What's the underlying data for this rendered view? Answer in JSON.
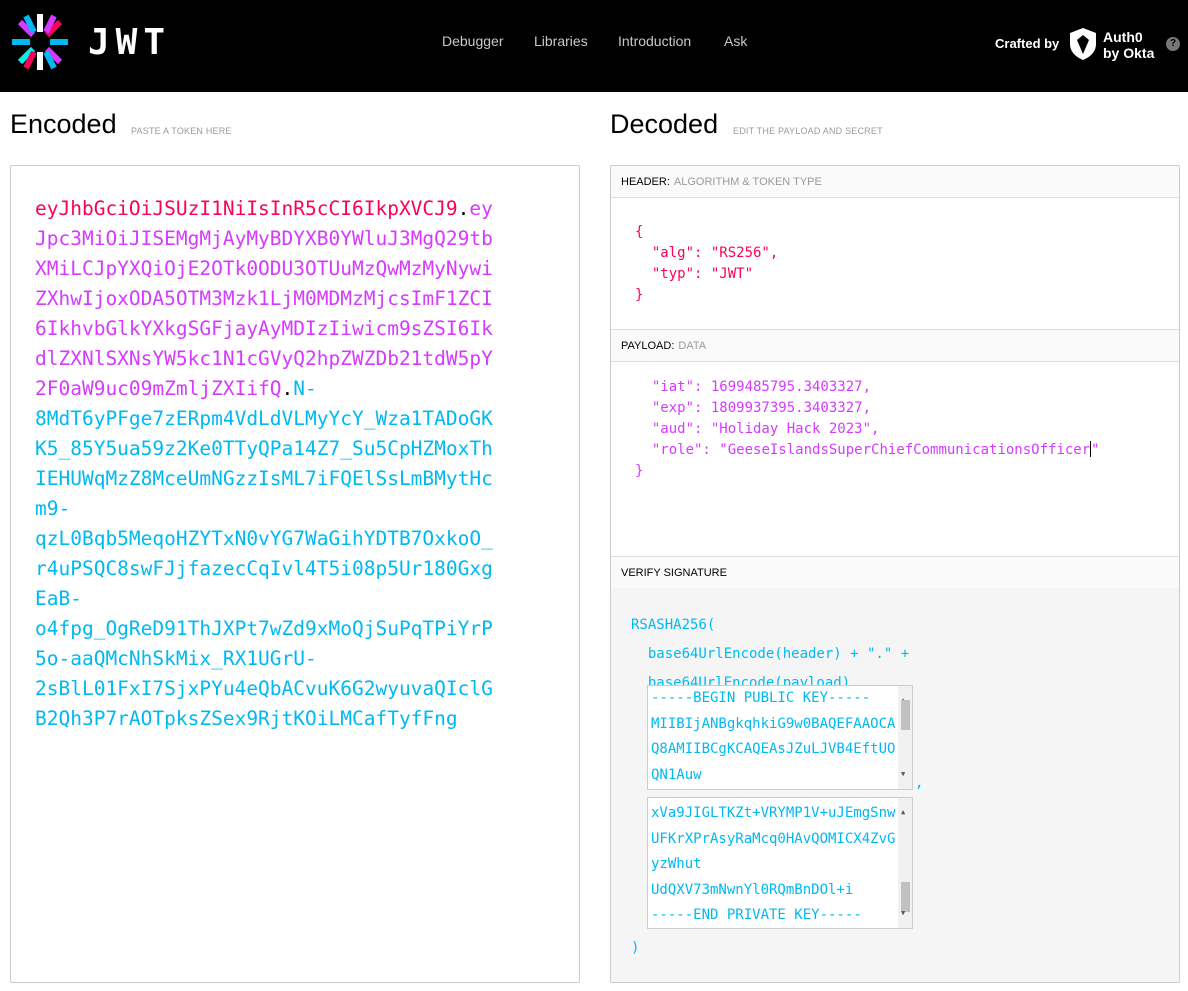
{
  "nav": {
    "brand": "JWT",
    "links": [
      "Debugger",
      "Libraries",
      "Introduction",
      "Ask"
    ],
    "crafted_by": "Crafted by",
    "auth0_line1": "Auth0",
    "auth0_line2": "by Okta",
    "help": "?"
  },
  "encoded": {
    "title": "Encoded",
    "subtitle": "PASTE A TOKEN HERE",
    "token_header": "eyJhbGciOiJSUzI1NiIsInR5cCI6IkpXVCJ9",
    "token_payload": "eyJpc3MiOiJISEMgMjAyMyBDYXB0YWluJ3MgQ29tbXMiLCJpYXQiOjE2OTk0ODU3OTUuMzQwMzMyNywiZXhwIjoxODA5OTM3Mzk1LjM0MDMzMjcsImF1ZCI6IkhvbGlkYXkgSGFjayAyMDIzIiwicm9sZSI6IkdlZXNlSXNsYW5kc1N1cGVyQ2hpZWZDb21tdW5pY2F0aW9uc09mZmljZXIifQ",
    "token_signature": "N-8MdT6yPFge7zERpm4VdLdVLMyYcY_Wza1TADoGKK5_85Y5ua59z2Ke0TTyQPa14Z7_Su5CpHZMoxThIEHUWqMzZ8MceUmNGzzIsML7iFQElSsLmBMytHcm9-qzL0Bqb5MeqoHZYTxN0vYG7WaGihYDTB7OxkoO_r4uPSQC8swFJjfazecCqIvl4T5i08p5Ur180GxgEaB-o4fpg_OgReD91ThJXPt7wZd9xMoQjSuPqTPiYrP5o-aaQMcNhSkMix_RX1UGrU-2sBlL01FxI7SjxPYu4eQbACvuK6G2wyuvaQIclGB2Qh3P7rAOTpksZSex9RjtKOiLMCafTyfFng",
    "lines": [
      "eyJhbGciOiJSUzI1NiIsInR5cCI6IkpXVCJ9",
      ".",
      "ey",
      "Jpc3MiOiJISEMgMjAyMyBDYXB0YWluJ3MgQ29tb",
      "XMiLCJpYXQiOjE2OTk0ODU3OTUuMzQwMzMyNywi",
      "ZXhwIjoxODA5OTM3Mzk1LjM0MDMzMjcsImF1ZCI",
      "6IkhvbGlkYXkgSGFjayAyMDIzIiwicm9sZSI6Ik",
      "dlZXNlSXNsYW5kc1N1cGVyQ2hpZWZDb21tdW5pY",
      "2F0aW9uc09mZmljZXIifQ",
      ".",
      "N-",
      "8MdT6yPFge7zERpm4VdLdVLMyYcY_Wza1TADoGK",
      "K5_85Y5ua59z2Ke0TTyQPa14Z7_Su5CpHZMoxTh",
      "IEHUWqMzZ8MceUmNGzzIsML7iFQElSsLmBMytHc",
      "m9-",
      "qzL0Bqb5MeqoHZYTxN0vYG7WaGihYDTB7OxkoO_",
      "r4uPSQC8swFJjfazecCqIvl4T5i08p5Ur180Gxg",
      "EaB-",
      "o4fpg_OgReD91ThJXPt7wZd9xMoQjSuPqTPiYrP",
      "5o-aaQMcNhSkMix_RX1UGrU-",
      "2sBlL01FxI7SjxPYu4eQbACvuK6G2wyuvaQIclG",
      "B2Qh3P7rAOTpksZSex9RjtKOiLMCafTyfFng"
    ]
  },
  "decoded": {
    "title": "Decoded",
    "subtitle": "EDIT THE PAYLOAD AND SECRET",
    "header_section": {
      "label": "HEADER:",
      "sublabel": "ALGORITHM & TOKEN TYPE"
    },
    "header_json": {
      "open": "{",
      "line1": "\"alg\": \"RS256\",",
      "line2": "\"typ\": \"JWT\"",
      "close": "}"
    },
    "payload_section": {
      "label": "PAYLOAD:",
      "sublabel": "DATA"
    },
    "payload_json": {
      "line1": "\"iat\": 1699485795.3403327,",
      "line2": "\"exp\": 1809937395.3403327,",
      "line3": "\"aud\": \"Holiday Hack 2023\",",
      "line4_key": "\"role\": ",
      "line4_value": "\"GeeseIslandsSuperChiefCommunicationsOfficer",
      "line4_end": "\"",
      "close": "}"
    },
    "verify_section": {
      "label": "VERIFY SIGNATURE"
    },
    "verify": {
      "fn": "RSASHA256(",
      "line1": "base64UrlEncode(header) + \".\" +",
      "line2": "base64UrlEncode(payload),",
      "comma": ",",
      "close": ")",
      "public_key_lines": [
        "-----BEGIN PUBLIC KEY-----",
        "MIIBIjANBgkqhkiG9w0BAQEFAAOCA",
        "Q8AMIIBCgKCAQEAsJZuLJVB4EftUO",
        "QN1Auw"
      ],
      "private_key_lines": [
        "xVa9JIGLTKZt+VRYMP1V+uJEmgSnw",
        "UFKrXPrAsyRaMcq0HAvQOMICX4ZvG",
        "yzWhut",
        "UdQXV73mNwnYl0RQmBnDOl+i",
        "-----END PRIVATE KEY-----"
      ]
    }
  },
  "colors": {
    "header": "#fb015b",
    "payload": "#d63aff",
    "signature": "#00b9f1"
  }
}
